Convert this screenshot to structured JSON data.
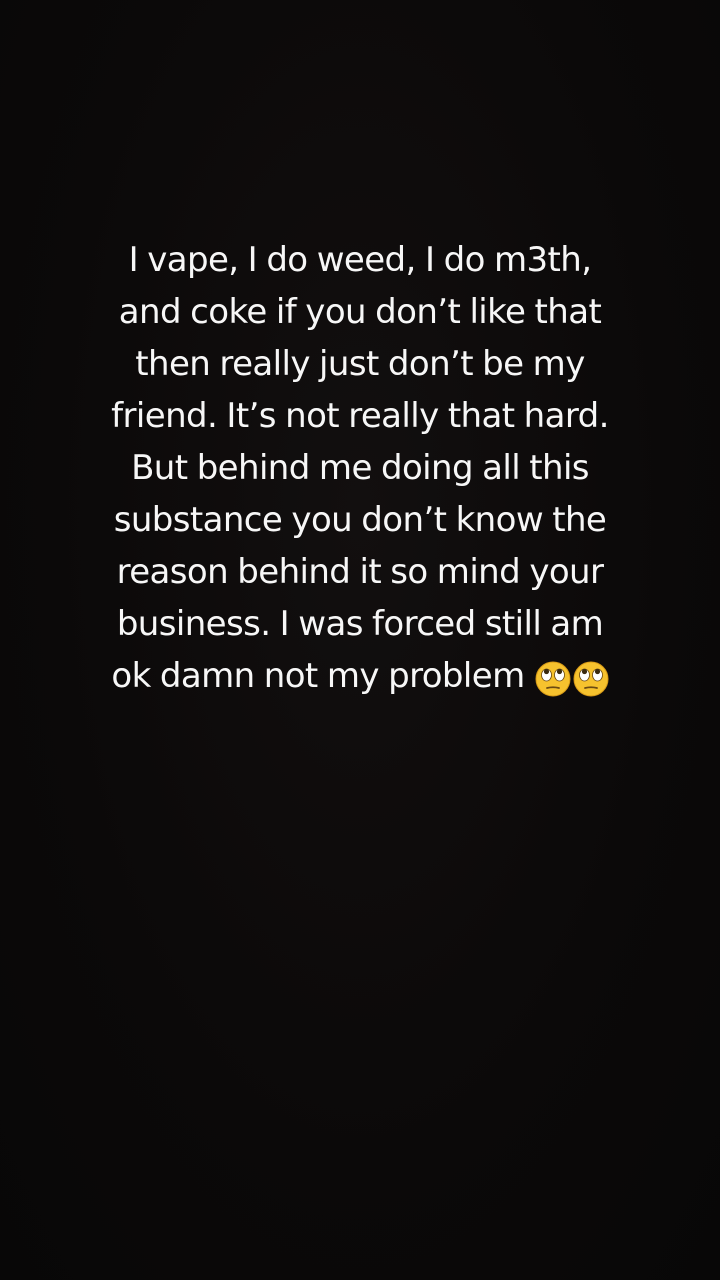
{
  "story": {
    "lines": [
      "I vape, I do weed, I do m3th,",
      "and coke if you don’t like that",
      "then really just don’t be my",
      "friend. It’s not really that hard.",
      "But behind me doing all this",
      "substance you don’t know the",
      "reason behind it so mind your",
      "business. I was forced still am",
      "ok damn not my problem"
    ],
    "emojis": [
      "eye-roll-emoji",
      "eye-roll-emoji"
    ]
  },
  "colors": {
    "background": "#0b0909",
    "text": "#f7f7f7",
    "emoji_face": "#f6c22e"
  }
}
